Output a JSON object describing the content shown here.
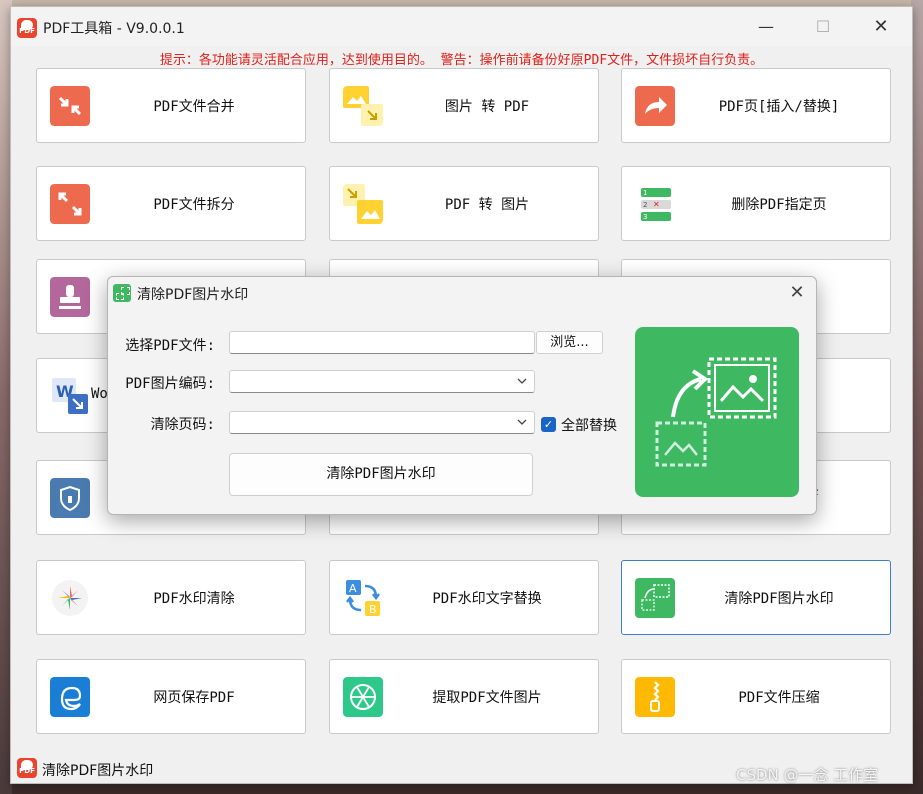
{
  "app": {
    "title": "PDF工具箱 - V9.0.0.1",
    "logo_text": "PDF"
  },
  "notice": "提示：各功能请灵活配合应用，达到使用目的。 警告：操作前请备份好原PDF文件，文件损坏自行负责。",
  "tools": [
    {
      "label": "PDF文件合并",
      "icon": "merge-icon",
      "color": "#ee6a4e"
    },
    {
      "label": "图片 转 PDF",
      "icon": "image-to-pdf-icon",
      "color": "#ffd232"
    },
    {
      "label": "PDF页[插入/替换]",
      "icon": "share-arrow-icon",
      "color": "#ee6a4e"
    },
    {
      "label": "PDF文件拆分",
      "icon": "split-icon",
      "color": "#ee6a4e"
    },
    {
      "label": "PDF 转 图片",
      "icon": "pdf-to-image-icon",
      "color": "#ffd232"
    },
    {
      "label": "删除PDF指定页",
      "icon": "numbered-list-icon",
      "color": "#3fb862"
    },
    {
      "label": "",
      "icon": "stamp-icon",
      "color": "#b4679a"
    },
    {
      "label": "",
      "icon": "hidden-icon",
      "color": "#cccccc"
    },
    {
      "label": "",
      "icon": "hidden-icon",
      "color": "#cccccc"
    },
    {
      "label": "Wo",
      "icon": "word-convert-icon",
      "color": "#3d6fc4"
    },
    {
      "label": "",
      "icon": "hidden-icon",
      "color": "#cccccc"
    },
    {
      "label": "",
      "icon": "hidden-icon",
      "color": "#cccccc"
    },
    {
      "label": "",
      "icon": "shield-icon",
      "color": "#4a7bb0"
    },
    {
      "label": "",
      "icon": "hidden-icon",
      "color": "#cccccc"
    },
    {
      "label": "DF",
      "icon": "hidden-icon",
      "color": "#cccccc"
    },
    {
      "label": "PDF水印清除",
      "icon": "sparkle-icon",
      "color": "#f0f0f0"
    },
    {
      "label": "PDF水印文字替换",
      "icon": "swap-text-icon",
      "color": "#ffd232"
    },
    {
      "label": "清除PDF图片水印",
      "icon": "image-watermark-icon",
      "color": "#3fb862"
    },
    {
      "label": "网页保存PDF",
      "icon": "edge-browser-icon",
      "color": "#1a7fd4"
    },
    {
      "label": "提取PDF文件图片",
      "icon": "aperture-icon",
      "color": "#2ec88a"
    },
    {
      "label": "PDF文件压缩",
      "icon": "zip-icon",
      "color": "#ffb900"
    }
  ],
  "status": {
    "text": "清除PDF图片水印",
    "logo_text": "PDF"
  },
  "watermark": "CSDN @一念 工作室",
  "dialog": {
    "title": "清除PDF图片水印",
    "select_file_label": "选择PDF文件:",
    "file_value": "",
    "browse_label": "浏览...",
    "encoding_label": "PDF图片编码:",
    "encoding_value": "",
    "page_label": "清除页码:",
    "page_value": "",
    "replace_all_label": "全部替换",
    "replace_all_checked": true,
    "action_label": "清除PDF图片水印"
  }
}
